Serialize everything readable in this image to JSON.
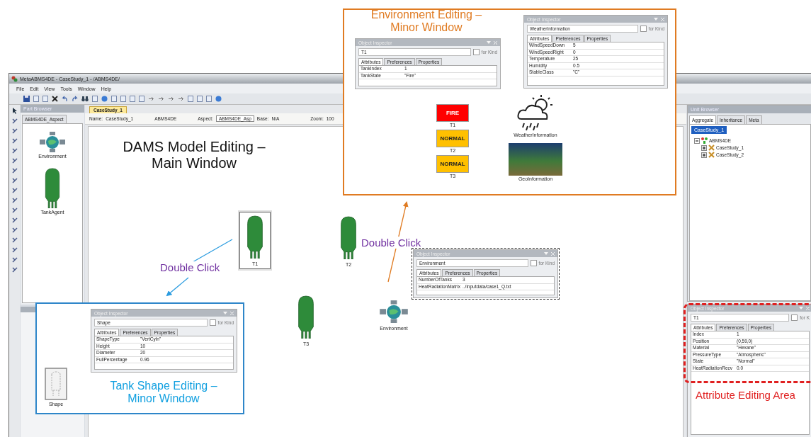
{
  "app": {
    "title": "MetaABMS4DE - CaseStudy_1 - /ABMS4DE/",
    "menu": [
      "File",
      "Edit",
      "View",
      "Tools",
      "Window",
      "Help"
    ],
    "part_browser": {
      "title": "Part Browser",
      "tab": "ABMS4DE_Aspect",
      "parts": [
        {
          "label": "Environment",
          "kind": "environment"
        },
        {
          "label": "TankAgent",
          "kind": "tank"
        }
      ]
    },
    "shape_part": {
      "label": "Shape"
    },
    "editor": {
      "tab": "CaseStudy_1",
      "name_label": "Name:",
      "name_value": "CaseStudy_1",
      "paradigm": "ABMS4DE",
      "aspect_label": "Aspect:",
      "aspect_value": "ABMS4DE_Asp",
      "base_label": "Base:",
      "base_value": "N/A",
      "zoom_label": "Zoom:",
      "zoom_value": "100"
    },
    "canvas_nodes": [
      {
        "label": "T1",
        "kind": "tank",
        "selected": true
      },
      {
        "label": "T2",
        "kind": "tank",
        "selected": false
      },
      {
        "label": "T3",
        "kind": "tank",
        "selected": false
      },
      {
        "label": "Environment",
        "kind": "environment",
        "selected": false
      }
    ],
    "unit_browser": {
      "title": "Unit Browser",
      "tabs": [
        {
          "label": "Aggregate",
          "selected": true
        },
        {
          "label": "Inheritance",
          "selected": false
        },
        {
          "label": "Meta",
          "selected": false
        }
      ],
      "search": "CaseStudy_1",
      "tree": [
        {
          "label": "ABMS4DE",
          "expanded": true,
          "children": [
            {
              "label": "CaseStudy_1",
              "expanded": false
            },
            {
              "label": "CaseStudy_2",
              "expanded": false
            }
          ]
        }
      ]
    },
    "object_inspector": {
      "title": "Object Inspector",
      "name": "T1",
      "for_kind": "for K",
      "for_kind_checked": false,
      "tabs": [
        {
          "label": "Attributes",
          "selected": true
        },
        {
          "label": "Preferences",
          "selected": false
        },
        {
          "label": "Properties",
          "selected": false
        }
      ],
      "rows": [
        {
          "name": "Index",
          "value": "1"
        },
        {
          "name": "Position",
          "value": "(0,59,0)"
        },
        {
          "name": "Material",
          "value": "\"Hexane\""
        },
        {
          "name": "PressureType",
          "value": "\"Atmospheric\""
        },
        {
          "name": "State",
          "value": "\"Normal\""
        },
        {
          "name": "HeatRadiationRecv",
          "value": "0.0"
        }
      ]
    }
  },
  "main_window_caption": "DAMS Model Editing – Main Window",
  "double_click_labels": [
    "Double Click",
    "Double Click"
  ],
  "environment_callout": {
    "caption": "Environment Editing – Minor Window",
    "inspectors": [
      {
        "title": "Object Inspector",
        "name": "T1",
        "for_kind": "for Kind",
        "for_kind_checked": false,
        "tabs": [
          {
            "label": "Attributes",
            "selected": true
          },
          {
            "label": "Preferences",
            "selected": false
          },
          {
            "label": "Properties",
            "selected": false
          }
        ],
        "rows": [
          {
            "name": "TankIndex",
            "value": "1"
          },
          {
            "name": "TankState",
            "value": "\"Fire\""
          }
        ]
      },
      {
        "title": "Object Inspector",
        "name": "WeatherInformation",
        "for_kind": "for Kind",
        "for_kind_checked": false,
        "tabs": [
          {
            "label": "Attributes",
            "selected": true
          },
          {
            "label": "Preferences",
            "selected": false
          },
          {
            "label": "Properties",
            "selected": false
          }
        ],
        "rows": [
          {
            "name": "WindSpeedDown",
            "value": "5"
          },
          {
            "name": "WindSpeedRight",
            "value": "0"
          },
          {
            "name": "Temperature",
            "value": "25"
          },
          {
            "name": "Humidity",
            "value": "0.5"
          },
          {
            "name": "StableClass",
            "value": "\"C\""
          }
        ]
      }
    ],
    "tank_states": [
      {
        "status": "FIRE",
        "label": "T1",
        "color": "#ff0000"
      },
      {
        "status": "NORMAL",
        "label": "T2",
        "color": "#ffc000"
      },
      {
        "status": "NORMAL",
        "label": "T3",
        "color": "#ffc000"
      }
    ],
    "objects": [
      {
        "label": "WeatherInformation",
        "kind": "weather"
      },
      {
        "label": "GeoInformation",
        "kind": "terrain"
      }
    ]
  },
  "environment_inspector": {
    "title": "Object Inspector",
    "name": "Environment",
    "for_kind": "for Kind",
    "for_kind_checked": false,
    "tabs": [
      {
        "label": "Attributes",
        "selected": true
      },
      {
        "label": "Preferences",
        "selected": false
      },
      {
        "label": "Properties",
        "selected": false
      }
    ],
    "rows": [
      {
        "name": "NumberOfTanks",
        "value": "3"
      },
      {
        "name": "HeatRadiationMatrix",
        "value": "../inputdata/case1_Q.txt"
      }
    ]
  },
  "shape_callout": {
    "caption": "Tank Shape Editing – Minor Window",
    "inspector": {
      "title": "Object Inspector",
      "name": "Shape",
      "for_kind": "for Kind",
      "for_kind_checked": false,
      "tabs": [
        {
          "label": "Attributes",
          "selected": true
        },
        {
          "label": "Preferences",
          "selected": false
        },
        {
          "label": "Properties",
          "selected": false
        }
      ],
      "rows": [
        {
          "name": "ShapeType",
          "value": "\"VertCyln\""
        },
        {
          "name": "Height",
          "value": "10"
        },
        {
          "name": "Diameter",
          "value": "20"
        },
        {
          "name": "FullPercentage",
          "value": "0.96"
        }
      ]
    }
  },
  "attribute_area_caption": "Attribute Editing Area"
}
